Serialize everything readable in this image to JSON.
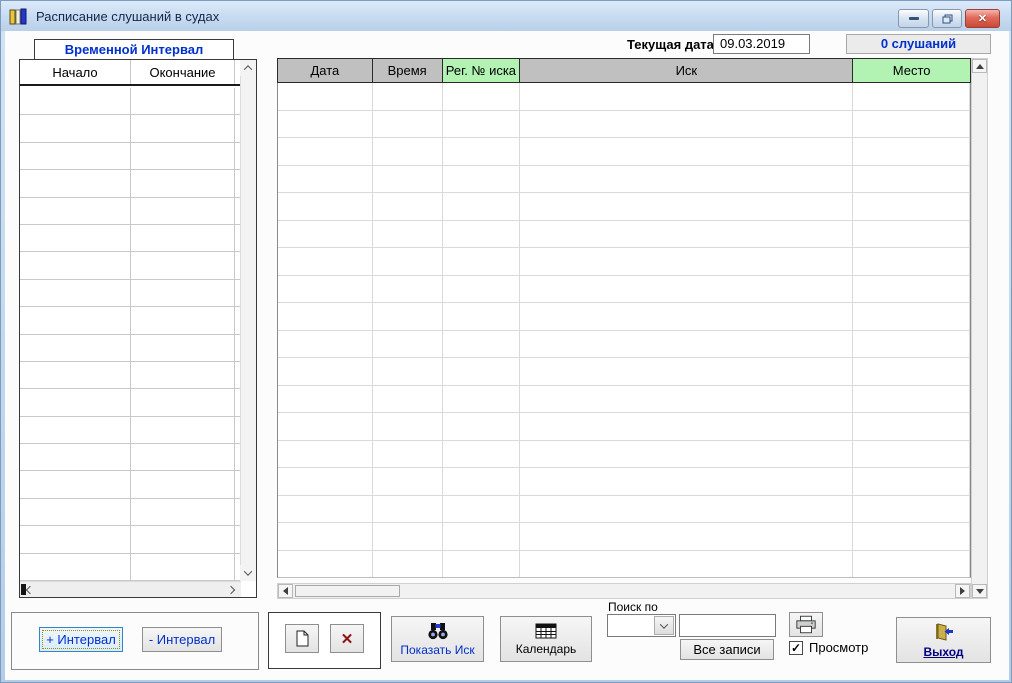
{
  "window": {
    "title": "Расписание слушаний в судах"
  },
  "titlebar_controls": {
    "minimize": "minimize",
    "restore": "restore",
    "close": "close"
  },
  "icons": {
    "close_glyph": "✕",
    "delete_glyph": "✕",
    "check_glyph": "✓"
  },
  "topbar": {
    "current_date_label": "Текущая дата",
    "current_date_value": "09.03.2019",
    "hearings_counter": "0 слушаний"
  },
  "interval_panel": {
    "title": "Временной Интервал",
    "columns": [
      "Начало",
      "Окончание"
    ],
    "rows": [],
    "add_button_label": "+ Интервал",
    "remove_button_label": "- Интервал"
  },
  "main_table": {
    "columns": [
      {
        "label": "Дата",
        "highlight": false
      },
      {
        "label": "Время",
        "highlight": false
      },
      {
        "label": "Рег. № иска",
        "highlight": true
      },
      {
        "label": "Иск",
        "highlight": false
      },
      {
        "label": "Место",
        "highlight": true
      }
    ],
    "rows": []
  },
  "toolbar": {
    "show_claim_label": "Показать Иск",
    "calendar_label": "Календарь",
    "search_by_label": "Поиск по",
    "search_combo_value": "",
    "search_input_value": "",
    "all_records_label": "Все записи",
    "preview_label": "Просмотр",
    "preview_checked": true,
    "exit_label": "Выход"
  },
  "colors": {
    "header_grey": "#c0c0c0",
    "header_green": "#b2f2b2",
    "accent_blue": "#0030cc",
    "navy_link": "#000080",
    "titlebar_text": "#14284b"
  }
}
